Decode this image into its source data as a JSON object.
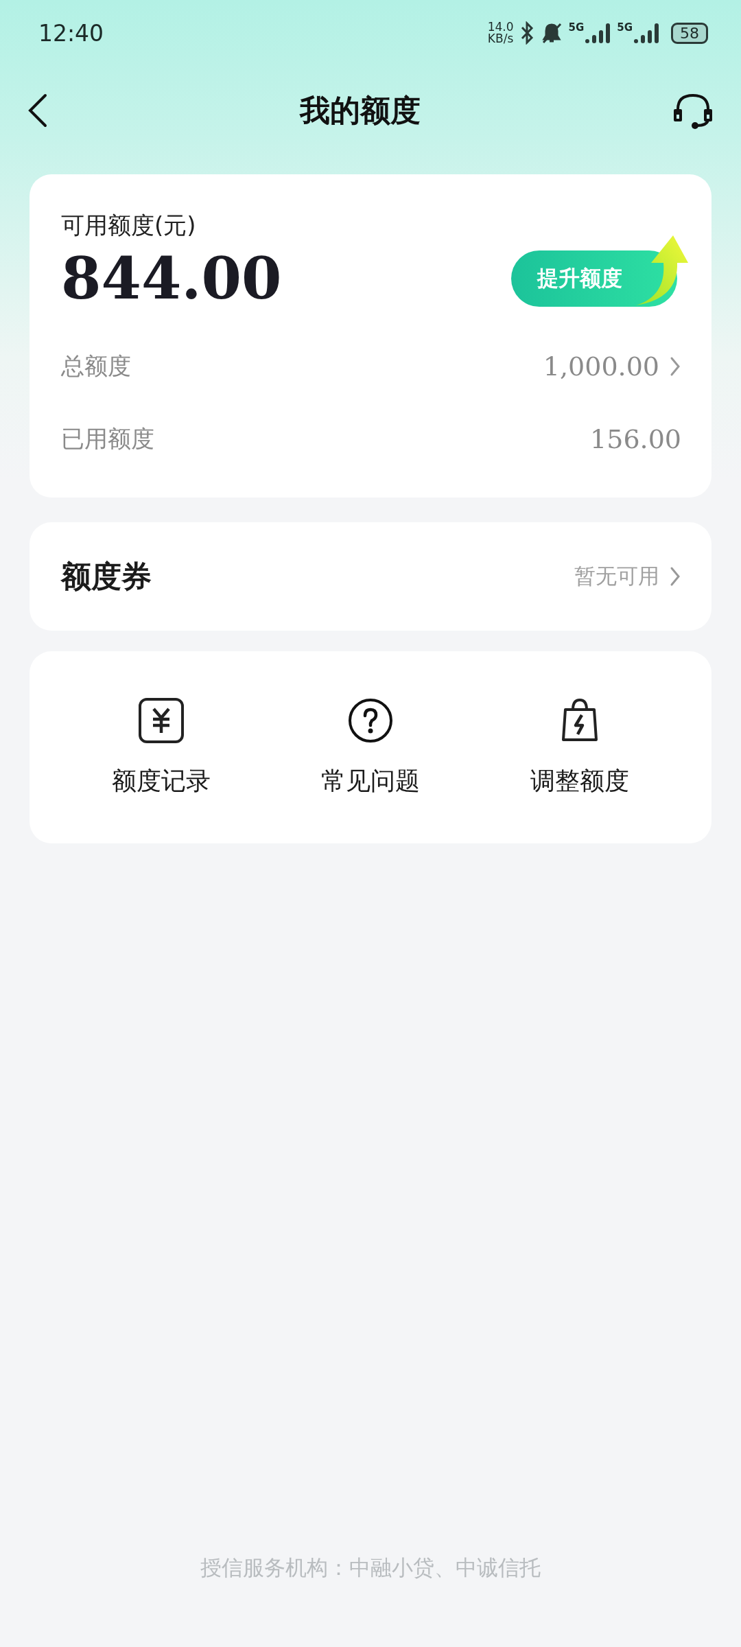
{
  "status_bar": {
    "time": "12:40",
    "net_speed": "14.0",
    "net_unit": "KB/s",
    "sim1": "5G",
    "sim2": "5G",
    "battery": "58"
  },
  "header": {
    "title": "我的额度"
  },
  "quota_card": {
    "label": "可用额度(元)",
    "amount": "844.00",
    "raise_button": "提升额度",
    "rows": [
      {
        "label": "总额度",
        "value": "1,000.00",
        "link": true
      },
      {
        "label": "已用额度",
        "value": "156.00",
        "link": false
      }
    ]
  },
  "coupon_card": {
    "label": "额度券",
    "status": "暂无可用"
  },
  "shortcuts": [
    {
      "kind": "record",
      "label": "额度记录"
    },
    {
      "kind": "faq",
      "label": "常见问题"
    },
    {
      "kind": "adjust",
      "label": "调整额度"
    }
  ],
  "footer": "授信服务机构：中融小贷、中诚信托"
}
